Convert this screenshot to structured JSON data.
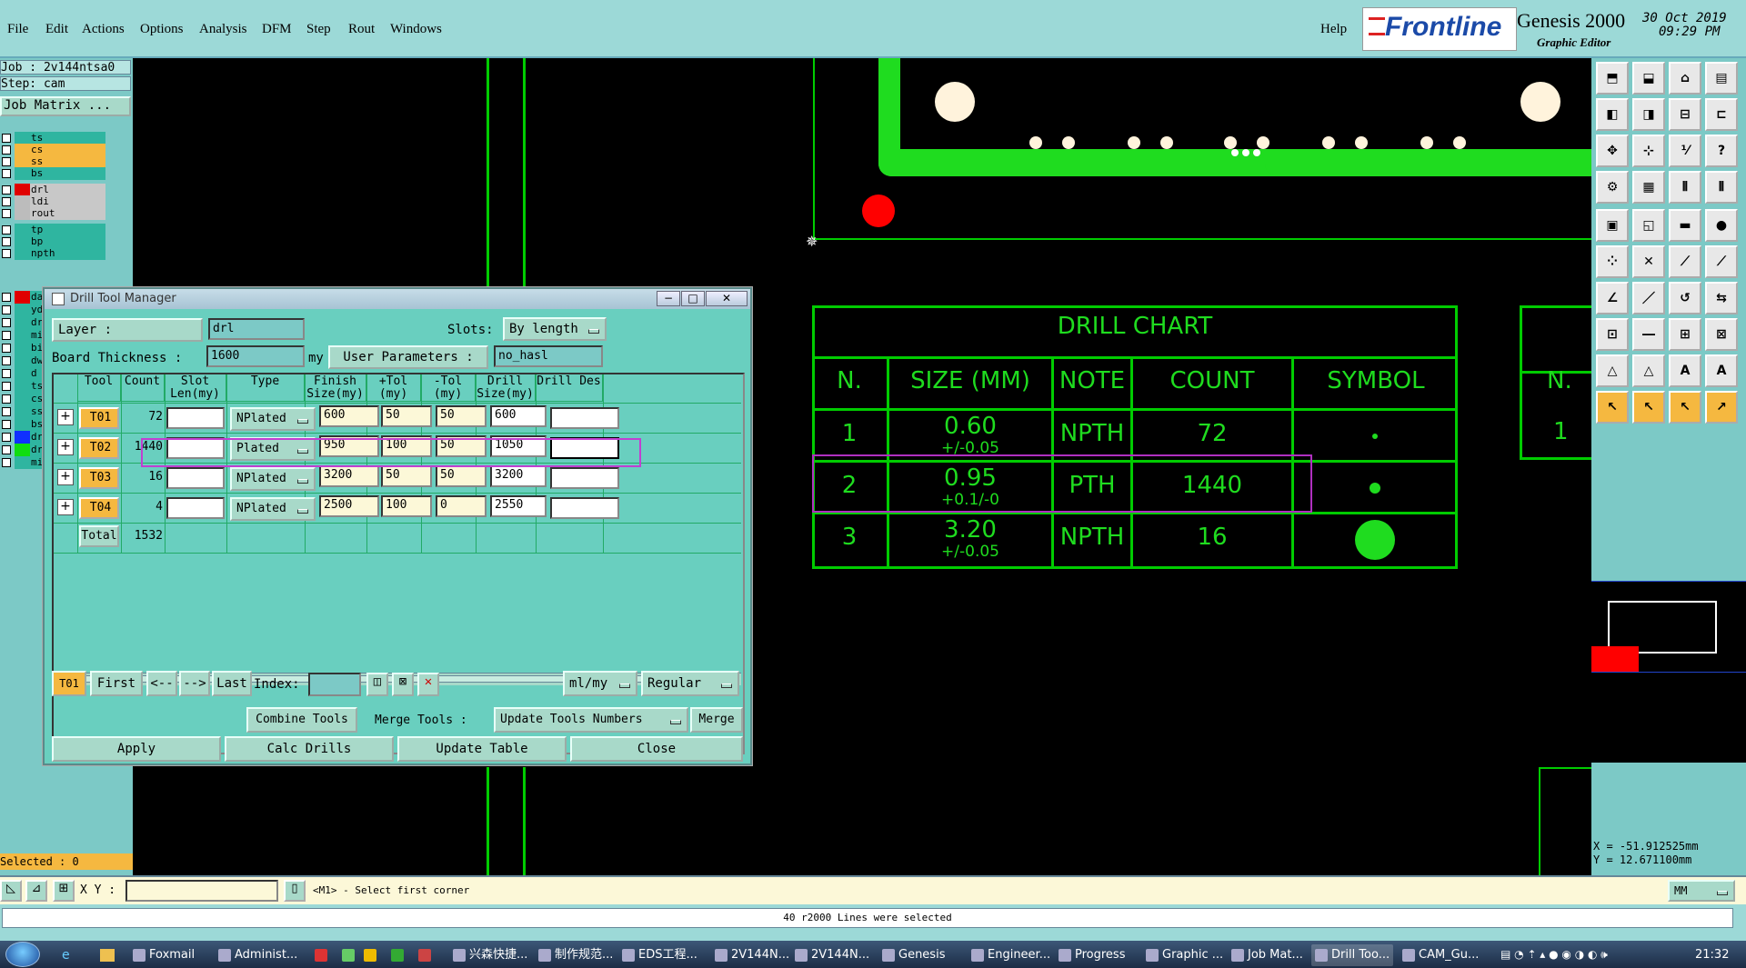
{
  "menu": {
    "file": "File",
    "edit": "Edit",
    "actions": "Actions",
    "options": "Options",
    "analysis": "Analysis",
    "dfm": "DFM",
    "step": "Step",
    "rout": "Rout",
    "windows": "Windows",
    "help": "Help"
  },
  "brand": {
    "logo": "Frontline",
    "product": "Genesis 2000",
    "subtitle": "Graphic Editor",
    "date": "30 Oct 2019",
    "time": "09:29 PM"
  },
  "left": {
    "job": "Job : 2v144ntsa0",
    "step": "Step: cam",
    "job_matrix": "Job Matrix ...",
    "selected": "Selected : 0",
    "layers": [
      {
        "name": "ts",
        "color": "#2fb5a0"
      },
      {
        "name": "cs",
        "color": "#f5b840"
      },
      {
        "name": "ss",
        "color": "#f5b840"
      },
      {
        "name": "bs",
        "color": "#2fb5a0"
      },
      {
        "name": "drl",
        "color": "#e00000",
        "nameColor": "#c8c8c8"
      },
      {
        "name": "ldi",
        "color": "#bcbcbc",
        "nameColor": "#c8c8c8"
      },
      {
        "name": "rout",
        "color": "#bcbcbc",
        "nameColor": "#c8c8c8"
      },
      {
        "name": "tp",
        "color": "#2fb5a0"
      },
      {
        "name": "bp",
        "color": "#2fb5a0"
      },
      {
        "name": "npth",
        "color": "#2fb5a0"
      }
    ],
    "partial": [
      "da",
      "yd",
      "dr",
      "mi",
      "bi",
      "dw",
      "d",
      "ts",
      "cs",
      "ss",
      "bs",
      "dr",
      "dr",
      "mi"
    ]
  },
  "chart": {
    "title": "DRILL CHART",
    "cols": [
      "N.",
      "SIZE (MM)",
      "NOTE",
      "COUNT",
      "SYMBOL"
    ],
    "rows": [
      {
        "n": "1",
        "size": "0.60",
        "tol": "+/-0.05",
        "note": "NPTH",
        "count": "72"
      },
      {
        "n": "2",
        "size": "0.95",
        "tol": "+0.1/-0",
        "note": "PTH",
        "count": "1440"
      },
      {
        "n": "3",
        "size": "3.20",
        "tol": "+/-0.05",
        "note": "NPTH",
        "count": "16"
      }
    ],
    "side_n": "N.",
    "side_1": "1"
  },
  "dtm": {
    "title": "Drill Tool Manager",
    "layer_label": "Layer :",
    "layer_value": "drl",
    "slots_label": "Slots:",
    "slots_value": "By length",
    "board_label": "Board Thickness :",
    "board_value": "1600",
    "board_unit": "my",
    "user_params": "User Parameters :",
    "user_value": "no_hasl",
    "headers": [
      "Tool",
      "Count",
      "Slot Len(my)",
      "Type",
      "Finish Size(my)",
      "+Tol (my)",
      "-Tol (my)",
      "Drill Size(my)",
      "Drill Des"
    ],
    "rows": [
      {
        "tool": "T01",
        "count": "72",
        "type": "NPlated",
        "finish": "600",
        "ptol": "50",
        "mtol": "50",
        "drill": "600"
      },
      {
        "tool": "T02",
        "count": "1440",
        "type": "Plated",
        "finish": "950",
        "ptol": "100",
        "mtol": "50",
        "drill": "1050"
      },
      {
        "tool": "T03",
        "count": "16",
        "type": "NPlated",
        "finish": "3200",
        "ptol": "50",
        "mtol": "50",
        "drill": "3200"
      },
      {
        "tool": "T04",
        "count": "4",
        "type": "NPlated",
        "finish": "2500",
        "ptol": "100",
        "mtol": "0",
        "drill": "2550"
      }
    ],
    "total_label": "Total",
    "total": "1532",
    "nav": {
      "cur": "T01",
      "first": "First",
      "prev": "<--",
      "next": "-->",
      "last": "Last",
      "index": "Index:",
      "units": "ml/my",
      "mode": "Regular"
    },
    "combine": "Combine Tools",
    "merge_tools": "Merge Tools :",
    "update_nums": "Update Tools Numbers",
    "merge": "Merge",
    "apply": "Apply",
    "calc": "Calc Drills",
    "update": "Update Table",
    "close": "Close"
  },
  "coords": {
    "x": "X = -51.912525mm",
    "y": "Y = 12.671100mm"
  },
  "status": {
    "xy_label": "X Y :",
    "prompt": "<M1> - Select first corner",
    "units": "MM",
    "message": "40 r2000 Lines were selected"
  },
  "taskbar": {
    "items": [
      "Foxmail",
      "Administ...",
      "兴森快捷...",
      "制作规范...",
      "EDS工程...",
      "2V144N...",
      "2V144N...",
      "Genesis",
      "Engineer...",
      "Progress",
      "Graphic ...",
      "Job Mat...",
      "Drill Too...",
      "CAM_Gu..."
    ],
    "clock": "21:32"
  }
}
